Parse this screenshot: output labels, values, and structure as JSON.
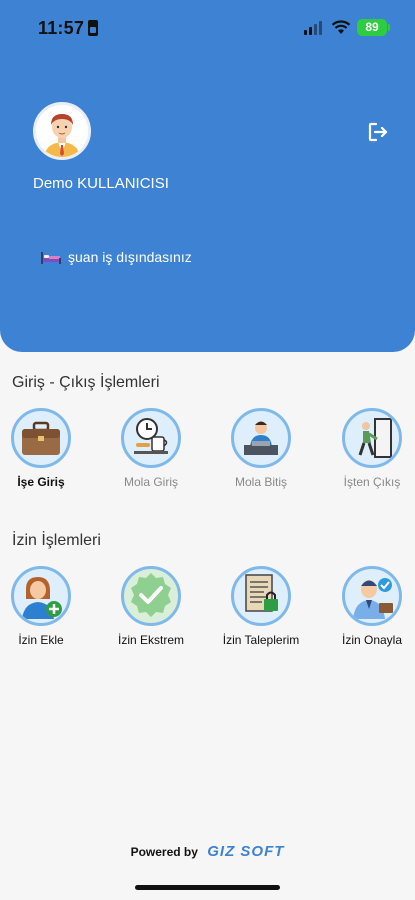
{
  "status_bar": {
    "time": "11:57",
    "battery": "89"
  },
  "user": {
    "name": "Demo KULLANICISI",
    "work_status": "şuan iş dışındasınız"
  },
  "sections": {
    "entry_exit": {
      "title": "Giriş - Çıkış İşlemleri",
      "items": [
        {
          "label": "İşe Giriş",
          "icon": "briefcase-icon",
          "state": "active"
        },
        {
          "label": "Mola Giriş",
          "icon": "clock-coffee-icon",
          "state": "disabled"
        },
        {
          "label": "Mola Bitiş",
          "icon": "worker-desk-icon",
          "state": "disabled"
        },
        {
          "label": "İşten Çıkış",
          "icon": "exit-door-icon",
          "state": "disabled"
        }
      ]
    },
    "leave": {
      "title": "İzin İşlemleri",
      "items": [
        {
          "label": "İzin Ekle",
          "icon": "add-person-icon"
        },
        {
          "label": "İzin Ekstrem",
          "icon": "check-badge-icon"
        },
        {
          "label": "İzin Taleplerim",
          "icon": "document-lock-icon"
        },
        {
          "label": "İzin Onayla",
          "icon": "approve-person-icon"
        }
      ]
    }
  },
  "footer": {
    "powered_by": "Powered by",
    "brand": "GIZ SOFT"
  },
  "colors": {
    "header": "#3e82d3",
    "ring": "#7fb9ec",
    "battery": "#2ecc40"
  }
}
